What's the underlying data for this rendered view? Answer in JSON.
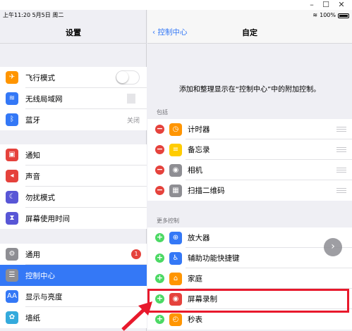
{
  "window": {
    "minimize": "–",
    "maximize": "☐",
    "close": "✕"
  },
  "statusbar": {
    "left": "上午11:20  5月5日 周二",
    "battery_text": "100%"
  },
  "settings": {
    "title": "设置",
    "group1": [
      {
        "label": "飞行模式",
        "icon": "airplane-icon",
        "color": "#ff9500",
        "glyph": "✈",
        "toggle": false
      },
      {
        "label": "无线局域网",
        "icon": "wifi-icon",
        "color": "#3478f6",
        "glyph": "≋"
      },
      {
        "label": "蓝牙",
        "icon": "bluetooth-icon",
        "color": "#3478f6",
        "glyph": "ᛒ",
        "value": "关闭"
      }
    ],
    "group2": [
      {
        "label": "通知",
        "icon": "notifications-icon",
        "color": "#e5423c",
        "glyph": "▣"
      },
      {
        "label": "声音",
        "icon": "sound-icon",
        "color": "#e5423c",
        "glyph": "◂"
      },
      {
        "label": "勿扰模式",
        "icon": "moon-icon",
        "color": "#5856d6",
        "glyph": "☾"
      },
      {
        "label": "屏幕使用时间",
        "icon": "hourglass-icon",
        "color": "#5856d6",
        "glyph": "⧗"
      }
    ],
    "group3": [
      {
        "label": "通用",
        "icon": "gear-icon",
        "color": "#8e8e93",
        "glyph": "⚙",
        "badge": "1"
      },
      {
        "label": "控制中心",
        "icon": "control-center-icon",
        "color": "#8e8e93",
        "glyph": "☰",
        "selected": true
      },
      {
        "label": "显示与亮度",
        "icon": "display-icon",
        "color": "#3478f6",
        "glyph": "AA"
      },
      {
        "label": "墙纸",
        "icon": "wallpaper-icon",
        "color": "#34aadc",
        "glyph": "✿"
      }
    ]
  },
  "detail": {
    "back_label": "控制中心",
    "title": "自定",
    "description": "添加和整理显示在“控制中心”中的附加控制。",
    "included_header": "包括",
    "included": [
      {
        "label": "计时器",
        "icon": "timer-icon",
        "color": "#ff9500",
        "glyph": "◷"
      },
      {
        "label": "备忘录",
        "icon": "notes-icon",
        "color": "#ffcc00",
        "glyph": "≡"
      },
      {
        "label": "相机",
        "icon": "camera-icon",
        "color": "#8e8e93",
        "glyph": "◉"
      },
      {
        "label": "扫描二维码",
        "icon": "qr-code-icon",
        "color": "#8e8e93",
        "glyph": "▦"
      }
    ],
    "more_header": "更多控制",
    "more": [
      {
        "label": "放大器",
        "icon": "magnifier-icon",
        "color": "#3478f6",
        "glyph": "⊕"
      },
      {
        "label": "辅助功能快捷键",
        "icon": "accessibility-icon",
        "color": "#3478f6",
        "glyph": "♿"
      },
      {
        "label": "家庭",
        "icon": "home-icon",
        "color": "#ff9500",
        "glyph": "⌂"
      },
      {
        "label": "屏幕录制",
        "icon": "screen-record-icon",
        "color": "#e5423c",
        "glyph": "◉"
      },
      {
        "label": "秒表",
        "icon": "stopwatch-icon",
        "color": "#ff9500",
        "glyph": "◴"
      }
    ]
  }
}
